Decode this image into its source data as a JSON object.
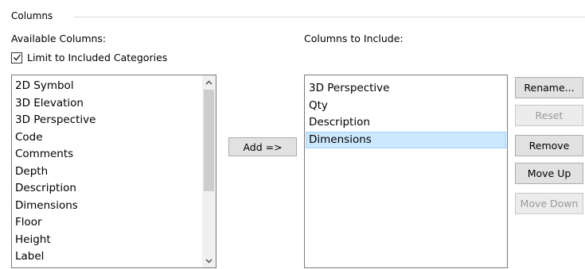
{
  "group": {
    "title": "Columns"
  },
  "available": {
    "label": "Available Columns:",
    "limit_checkbox": {
      "label": "Limit to Included Categories",
      "checked": true
    },
    "items": [
      "2D Symbol",
      "3D Elevation",
      "3D Perspective",
      "Code",
      "Comments",
      "Depth",
      "Description",
      "Dimensions",
      "Floor",
      "Height",
      "Label"
    ]
  },
  "add_button": {
    "label": "Add =>"
  },
  "included": {
    "label": "Columns to Include:",
    "items": [
      "3D Perspective",
      "Qty",
      "Description",
      "Dimensions"
    ],
    "selected": "Dimensions"
  },
  "buttons": {
    "rename": {
      "label": "Rename...",
      "enabled": true
    },
    "reset": {
      "label": "Reset",
      "enabled": false
    },
    "remove": {
      "label": "Remove",
      "enabled": true
    },
    "move_up": {
      "label": "Move Up",
      "enabled": true
    },
    "move_down": {
      "label": "Move Down",
      "enabled": false
    }
  },
  "colors": {
    "selection_bg": "#cce8ff",
    "selection_border": "#99d1ff",
    "button_bg": "#e1e1e1",
    "disabled_text": "#9a9a9a"
  },
  "icons": {
    "check": "check-icon",
    "scroll_up": "chevron-up-icon",
    "scroll_down": "chevron-down-icon"
  }
}
